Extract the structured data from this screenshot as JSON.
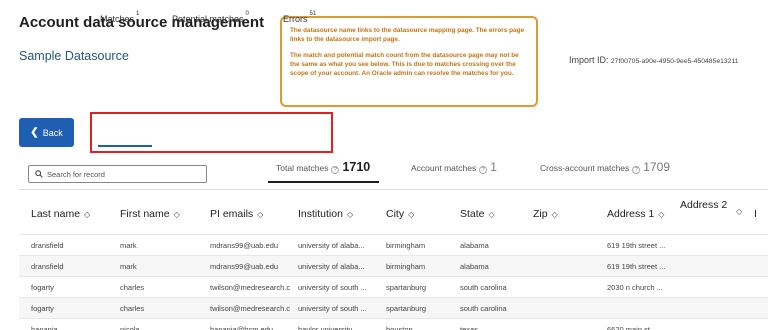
{
  "page": {
    "title": "Account data source management",
    "datasource_name": "Sample Datasource",
    "import_id_label": "Import ID:",
    "import_id_value": "27f00705-a90e-4950-9ee5-450485e13211"
  },
  "callout": {
    "para1": "The datasource name links to the datasource mapping page. The errors page links to the datasource import page.",
    "para2": "The match and potential match count from the datasource page may not be the same as what you see below. This is due to matches crossing over the scope of your account. An Oracle admin can resolve the matches for you."
  },
  "back_button": {
    "label": "Back",
    "icon": "chevron-left-icon"
  },
  "tabs": [
    {
      "label": "Matches",
      "count": "1"
    },
    {
      "label": "Potential matches",
      "count": "0"
    },
    {
      "label": "Errors",
      "count": "51"
    }
  ],
  "search": {
    "placeholder": "Search for record",
    "icon": "search-icon"
  },
  "stats": {
    "total": {
      "label": "Total matches",
      "value": "1710"
    },
    "account": {
      "label": "Account matches",
      "value": "1"
    },
    "cross": {
      "label": "Cross-account matches",
      "value": "1709"
    },
    "help_glyph": "?"
  },
  "table": {
    "columns": [
      "Last name",
      "First name",
      "PI emails",
      "Institution",
      "City",
      "State",
      "Zip",
      "Address 1",
      "Address 2",
      "I"
    ],
    "rows": [
      [
        "dransfield",
        "mark",
        "mdrans99@uab.edu",
        "university of alaba...",
        "birmingham",
        "alabama",
        "",
        "619 19th street ..."
      ],
      [
        "dransfield",
        "mark",
        "mdrans99@uab.edu",
        "university of alaba...",
        "birmingham",
        "alabama",
        "",
        "619 19th street ..."
      ],
      [
        "fogarty",
        "charles",
        "twilson@medresearch.c",
        "university of south ...",
        "spartanburg",
        "south carolina",
        "",
        "2030 n church ..."
      ],
      [
        "fogarty",
        "charles",
        "twilson@medresearch.c",
        "university of south ...",
        "spartanburg",
        "south carolina",
        "",
        ""
      ],
      [
        "hanania",
        "nicola",
        "hanania@bcm.edu",
        "baylor university",
        "houston",
        "texas",
        "",
        "6620 main st"
      ]
    ]
  },
  "colors": {
    "accent": "#1e5eb3",
    "callout_border": "#dd9a2e",
    "callout_text": "#c17612",
    "highlight_box": "#e02121"
  }
}
